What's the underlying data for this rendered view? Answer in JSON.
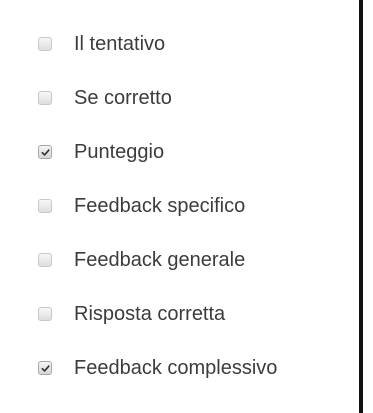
{
  "options": [
    {
      "label": "Il tentativo",
      "checked": false
    },
    {
      "label": "Se corretto",
      "checked": false
    },
    {
      "label": "Punteggio",
      "checked": true
    },
    {
      "label": "Feedback specifico",
      "checked": false
    },
    {
      "label": "Feedback generale",
      "checked": false
    },
    {
      "label": "Risposta corretta",
      "checked": false
    },
    {
      "label": "Feedback complessivo",
      "checked": true
    }
  ],
  "colors": {
    "label_text": "#3c3c3c",
    "checkbox_border": "#c9c9c9",
    "check_mark": "#333333",
    "right_border": "#111111"
  }
}
